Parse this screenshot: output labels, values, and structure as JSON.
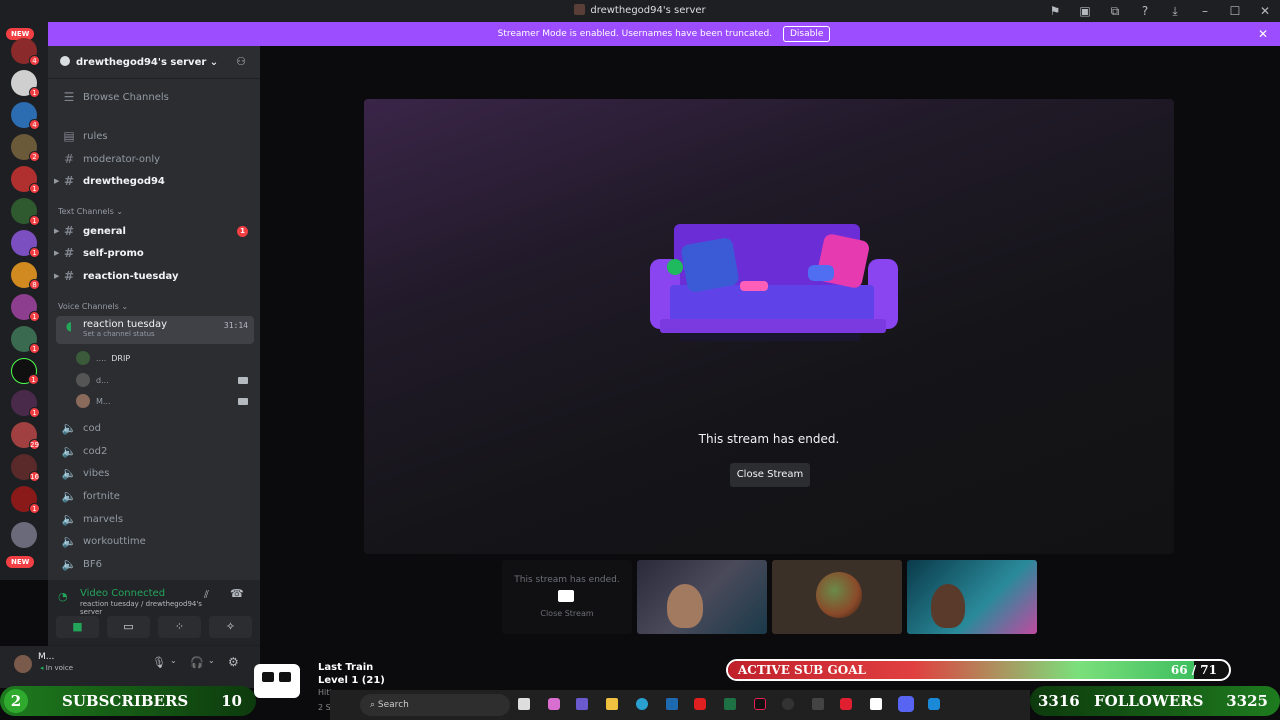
{
  "titlebar": {
    "title": "drewthegod94's server"
  },
  "banner": {
    "text": "Streamer Mode is enabled. Usernames have been truncated.",
    "button": "Disable"
  },
  "server_list": {
    "new_label_top": "NEW",
    "new_label_bottom": "NEW",
    "badges": [
      "4",
      "1",
      "4",
      "2",
      "1",
      "1",
      "1",
      "8",
      "1",
      "1",
      "1",
      "1",
      "29",
      "16",
      "1"
    ]
  },
  "sidebar": {
    "server_name": "drewthegod94's server",
    "browse_channels": "Browse Channels",
    "channels_top": [
      "rules",
      "moderator-only",
      "drewthegod94"
    ],
    "text_category": "Text Channels",
    "text_channels": [
      "general",
      "self-promo",
      "reaction-tuesday"
    ],
    "general_unread": "1",
    "voice_category": "Voice Channels",
    "active_voice": {
      "name": "reaction tuesday",
      "time": "31:14",
      "status": "Set a channel status"
    },
    "voice_users": [
      {
        "name": "....",
        "tag": "DRIP"
      },
      {
        "name": "d..."
      },
      {
        "name": "M..."
      }
    ],
    "voice_channels": [
      "cod",
      "cod2",
      "vibes",
      "fortnite",
      "marvels",
      "workouttime",
      "BF6"
    ]
  },
  "voice_panel": {
    "title": "Video Connected",
    "subtitle": "reaction tuesday / drewthegod94's server"
  },
  "user_panel": {
    "name": "M...",
    "status": "In voice"
  },
  "stage": {
    "message": "This stream has ended.",
    "close_button": "Close Stream"
  },
  "thumbnails": {
    "ended_text": "This stream has ended.",
    "ended_close": "Close Stream"
  },
  "overlay": {
    "now_playing_title": "Last Train",
    "now_playing_level": "Level 1  (21)",
    "now_playing_sub1": "Hitts",
    "now_playing_sub2": "2 Subs",
    "subscribers_left": "2",
    "subscribers_label": "SUBSCRIBERS",
    "subscribers_right": "10",
    "followers_left": "3316",
    "followers_label": "FOLLOWERS",
    "followers_right": "3325",
    "goal_label": "ACTIVE SUB GOAL",
    "goal_value": "66 / 71",
    "goal_fraction": 0.93,
    "search": "Search"
  },
  "colors": {
    "accent": "#9b4dff",
    "voice_green": "#23a55a",
    "badge_red": "#f23f43"
  }
}
